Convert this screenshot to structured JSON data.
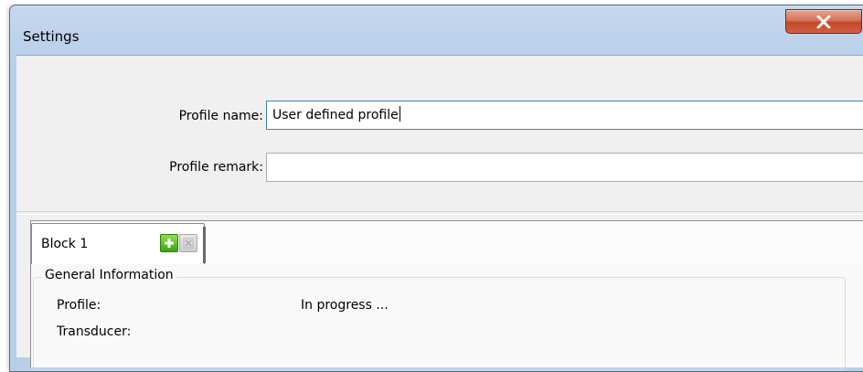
{
  "window": {
    "title": "Settings",
    "close_glyph": "X"
  },
  "form": {
    "profile_name_label": "Profile name:",
    "profile_name_value": "User defined profile",
    "profile_remark_label": "Profile remark:",
    "profile_remark_value": ""
  },
  "tabs": [
    {
      "label": "Block 1",
      "active": true
    }
  ],
  "tab_buttons": {
    "add_icon": "plus-icon",
    "remove_icon": "remove-icon"
  },
  "general_info": {
    "title": "General Information",
    "rows": [
      {
        "label": "Profile:",
        "value": "In progress ..."
      },
      {
        "label": "Transducer:",
        "value": ""
      }
    ]
  },
  "colors": {
    "title_bar": "#bed3ec",
    "close_button": "#c4472b",
    "add_button": "#3aa314",
    "client_bg": "#f0f0f0"
  }
}
